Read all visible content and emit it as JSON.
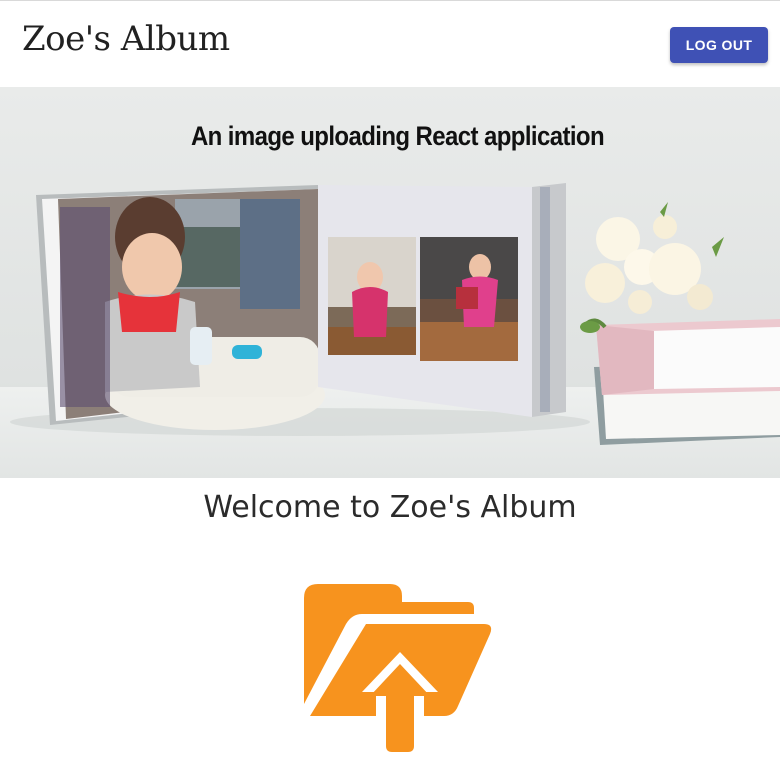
{
  "header": {
    "title": "Zoe's Album",
    "logout_label": "LOG OUT",
    "button_color": "#3f51b5"
  },
  "banner": {
    "caption": "An image uploading React application",
    "description_icon": "photo-album-banner"
  },
  "main": {
    "welcome_text": "Welcome to Zoe's Album",
    "upload_icon": "folder-upload-icon",
    "upload_icon_color": "#f7931e"
  }
}
